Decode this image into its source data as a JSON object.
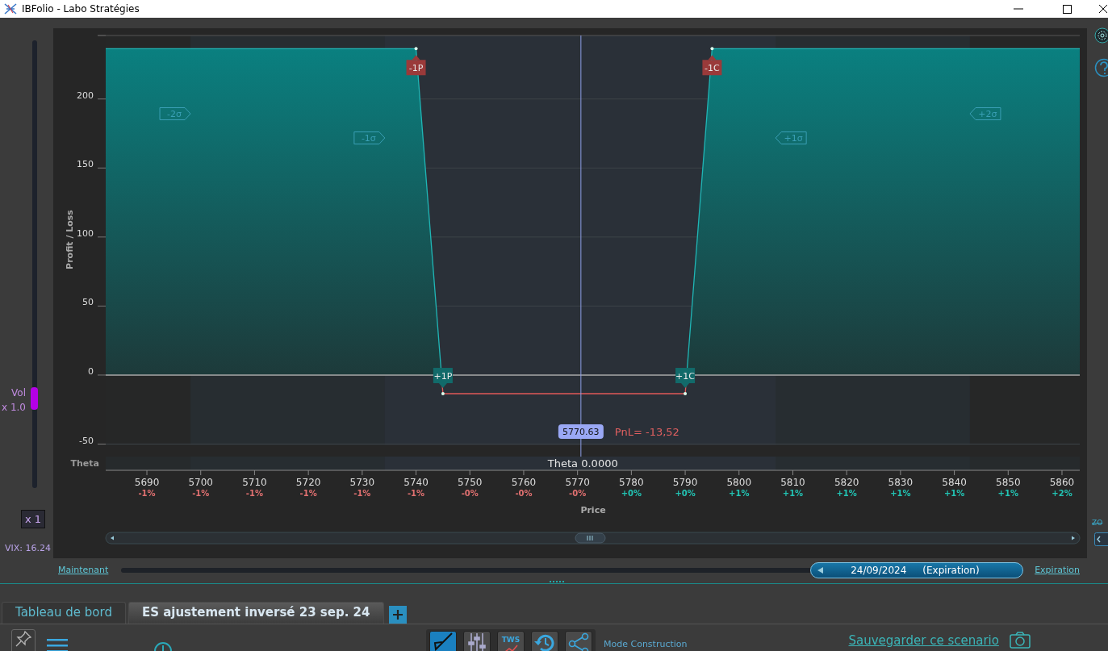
{
  "window": {
    "title": "IBFolio - Labo Stratégies"
  },
  "vol_slider": {
    "label": "Vol",
    "multiplier": "x 1.0",
    "level": 0.2
  },
  "scale_button": {
    "label": "x 1"
  },
  "vix": "VIX: 16.24",
  "side_tools": {
    "zoom_label": "ZO"
  },
  "chart": {
    "chart_data": {
      "type": "area",
      "xlabel": "Price",
      "ylabel": "Profit / Loss",
      "grid": true,
      "x": [
        5682.35,
        5740,
        5745,
        5790,
        5795,
        5863.3
      ],
      "series": [
        {
          "color": "#1fb5b5",
          "values": [
            236.5,
            236.5,
            -13.5,
            -13.5,
            236.5,
            236.5
          ]
        }
      ],
      "xlim": [
        5682.35,
        5863.3
      ],
      "ylim": [
        -50,
        246
      ],
      "xticks": [
        5690,
        5700,
        5710,
        5720,
        5730,
        5740,
        5750,
        5760,
        5770,
        5780,
        5790,
        5800,
        5810,
        5820,
        5830,
        5840,
        5850,
        5860
      ],
      "yticks": [
        -50,
        0,
        50,
        100,
        150,
        200
      ],
      "bands": [
        {
          "axis": "x",
          "from": 5698.1,
          "to": 5842.9,
          "color": "#272d31"
        },
        {
          "axis": "x",
          "from": 5734.2,
          "to": 5806.8,
          "color": "#2a3038"
        }
      ],
      "ref_lines": [
        {
          "axis": "x",
          "value": 5770.63,
          "label": "5770.63"
        }
      ],
      "annotations": [
        {
          "x": 5740,
          "y": 236.5,
          "text": "-1P"
        },
        {
          "x": 5745,
          "y": -13.5,
          "text": "+1P"
        },
        {
          "x": 5790,
          "y": -13.5,
          "text": "+1C"
        },
        {
          "x": 5795,
          "y": 236.5,
          "text": "-1C"
        }
      ]
    },
    "sigma_tags": [
      "-2σ",
      "-1σ",
      "+1σ",
      "+2σ"
    ],
    "pnl": "PnL= -13,52",
    "theta_label": "Theta",
    "theta_reading": "Theta 0.0000",
    "change_labels": [
      {
        "text": "-1%",
        "color": "#e07070"
      },
      {
        "text": "-1%",
        "color": "#e07070"
      },
      {
        "text": "-1%",
        "color": "#e07070"
      },
      {
        "text": "-1%",
        "color": "#e07070"
      },
      {
        "text": "-1%",
        "color": "#e07070"
      },
      {
        "text": "-1%",
        "color": "#e07070"
      },
      {
        "text": "-0%",
        "color": "#e07070"
      },
      {
        "text": "-0%",
        "color": "#e07070"
      },
      {
        "text": "-0%",
        "color": "#e07070"
      },
      {
        "text": "+0%",
        "color": "#22c3b3"
      },
      {
        "text": "+0%",
        "color": "#22c3b3"
      },
      {
        "text": "+1%",
        "color": "#22c3b3"
      },
      {
        "text": "+1%",
        "color": "#22c3b3"
      },
      {
        "text": "+1%",
        "color": "#22c3b3"
      },
      {
        "text": "+1%",
        "color": "#22c3b3"
      },
      {
        "text": "+1%",
        "color": "#22c3b3"
      },
      {
        "text": "+1%",
        "color": "#22c3b3"
      },
      {
        "text": "+2%",
        "color": "#22c3b3"
      }
    ]
  },
  "timeline": {
    "start_link": "Maintenant",
    "date": "24/09/2024",
    "date_note": "(Expiration)",
    "end_link": "Expiration",
    "level": 1
  },
  "tabs": [
    {
      "label": "Tableau de bord",
      "selected": false
    },
    {
      "label": "ES ajustement inversé 23 sep. 24",
      "selected": true
    }
  ],
  "toolbar": {
    "tools": [
      {
        "kind": "trowel",
        "selected": true
      },
      {
        "kind": "sliders",
        "selected": false
      },
      {
        "kind": "tws",
        "label": "TWS",
        "selected": false
      },
      {
        "kind": "history",
        "selected": false
      },
      {
        "kind": "share",
        "selected": false
      }
    ],
    "mode": "Mode Construction",
    "save_link": "Sauvegarder ce scenario"
  }
}
